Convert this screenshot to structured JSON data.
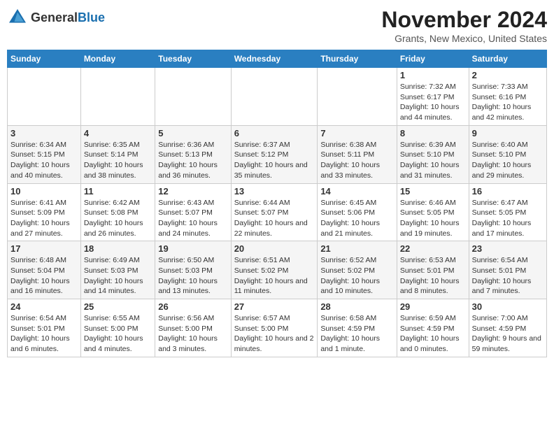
{
  "logo": {
    "general": "General",
    "blue": "Blue"
  },
  "header": {
    "month": "November 2024",
    "location": "Grants, New Mexico, United States"
  },
  "weekdays": [
    "Sunday",
    "Monday",
    "Tuesday",
    "Wednesday",
    "Thursday",
    "Friday",
    "Saturday"
  ],
  "weeks": [
    [
      {
        "day": "",
        "info": ""
      },
      {
        "day": "",
        "info": ""
      },
      {
        "day": "",
        "info": ""
      },
      {
        "day": "",
        "info": ""
      },
      {
        "day": "",
        "info": ""
      },
      {
        "day": "1",
        "info": "Sunrise: 7:32 AM\nSunset: 6:17 PM\nDaylight: 10 hours and 44 minutes."
      },
      {
        "day": "2",
        "info": "Sunrise: 7:33 AM\nSunset: 6:16 PM\nDaylight: 10 hours and 42 minutes."
      }
    ],
    [
      {
        "day": "3",
        "info": "Sunrise: 6:34 AM\nSunset: 5:15 PM\nDaylight: 10 hours and 40 minutes."
      },
      {
        "day": "4",
        "info": "Sunrise: 6:35 AM\nSunset: 5:14 PM\nDaylight: 10 hours and 38 minutes."
      },
      {
        "day": "5",
        "info": "Sunrise: 6:36 AM\nSunset: 5:13 PM\nDaylight: 10 hours and 36 minutes."
      },
      {
        "day": "6",
        "info": "Sunrise: 6:37 AM\nSunset: 5:12 PM\nDaylight: 10 hours and 35 minutes."
      },
      {
        "day": "7",
        "info": "Sunrise: 6:38 AM\nSunset: 5:11 PM\nDaylight: 10 hours and 33 minutes."
      },
      {
        "day": "8",
        "info": "Sunrise: 6:39 AM\nSunset: 5:10 PM\nDaylight: 10 hours and 31 minutes."
      },
      {
        "day": "9",
        "info": "Sunrise: 6:40 AM\nSunset: 5:10 PM\nDaylight: 10 hours and 29 minutes."
      }
    ],
    [
      {
        "day": "10",
        "info": "Sunrise: 6:41 AM\nSunset: 5:09 PM\nDaylight: 10 hours and 27 minutes."
      },
      {
        "day": "11",
        "info": "Sunrise: 6:42 AM\nSunset: 5:08 PM\nDaylight: 10 hours and 26 minutes."
      },
      {
        "day": "12",
        "info": "Sunrise: 6:43 AM\nSunset: 5:07 PM\nDaylight: 10 hours and 24 minutes."
      },
      {
        "day": "13",
        "info": "Sunrise: 6:44 AM\nSunset: 5:07 PM\nDaylight: 10 hours and 22 minutes."
      },
      {
        "day": "14",
        "info": "Sunrise: 6:45 AM\nSunset: 5:06 PM\nDaylight: 10 hours and 21 minutes."
      },
      {
        "day": "15",
        "info": "Sunrise: 6:46 AM\nSunset: 5:05 PM\nDaylight: 10 hours and 19 minutes."
      },
      {
        "day": "16",
        "info": "Sunrise: 6:47 AM\nSunset: 5:05 PM\nDaylight: 10 hours and 17 minutes."
      }
    ],
    [
      {
        "day": "17",
        "info": "Sunrise: 6:48 AM\nSunset: 5:04 PM\nDaylight: 10 hours and 16 minutes."
      },
      {
        "day": "18",
        "info": "Sunrise: 6:49 AM\nSunset: 5:03 PM\nDaylight: 10 hours and 14 minutes."
      },
      {
        "day": "19",
        "info": "Sunrise: 6:50 AM\nSunset: 5:03 PM\nDaylight: 10 hours and 13 minutes."
      },
      {
        "day": "20",
        "info": "Sunrise: 6:51 AM\nSunset: 5:02 PM\nDaylight: 10 hours and 11 minutes."
      },
      {
        "day": "21",
        "info": "Sunrise: 6:52 AM\nSunset: 5:02 PM\nDaylight: 10 hours and 10 minutes."
      },
      {
        "day": "22",
        "info": "Sunrise: 6:53 AM\nSunset: 5:01 PM\nDaylight: 10 hours and 8 minutes."
      },
      {
        "day": "23",
        "info": "Sunrise: 6:54 AM\nSunset: 5:01 PM\nDaylight: 10 hours and 7 minutes."
      }
    ],
    [
      {
        "day": "24",
        "info": "Sunrise: 6:54 AM\nSunset: 5:01 PM\nDaylight: 10 hours and 6 minutes."
      },
      {
        "day": "25",
        "info": "Sunrise: 6:55 AM\nSunset: 5:00 PM\nDaylight: 10 hours and 4 minutes."
      },
      {
        "day": "26",
        "info": "Sunrise: 6:56 AM\nSunset: 5:00 PM\nDaylight: 10 hours and 3 minutes."
      },
      {
        "day": "27",
        "info": "Sunrise: 6:57 AM\nSunset: 5:00 PM\nDaylight: 10 hours and 2 minutes."
      },
      {
        "day": "28",
        "info": "Sunrise: 6:58 AM\nSunset: 4:59 PM\nDaylight: 10 hours and 1 minute."
      },
      {
        "day": "29",
        "info": "Sunrise: 6:59 AM\nSunset: 4:59 PM\nDaylight: 10 hours and 0 minutes."
      },
      {
        "day": "30",
        "info": "Sunrise: 7:00 AM\nSunset: 4:59 PM\nDaylight: 9 hours and 59 minutes."
      }
    ]
  ]
}
